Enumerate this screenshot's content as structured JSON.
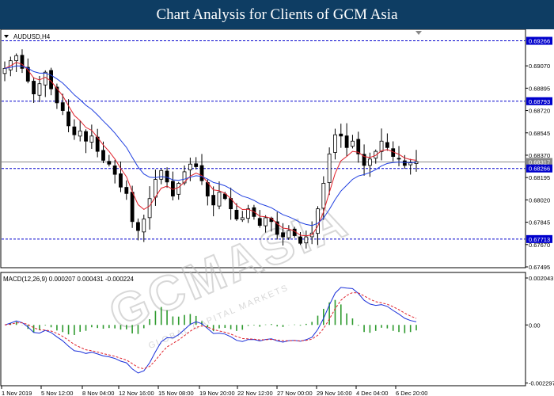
{
  "header": {
    "title": "Chart Analysis for Clients of GCM Asia"
  },
  "watermark": {
    "text": "GCMASIA",
    "sub": "GLOBAL CAPITAL MARKETS"
  },
  "chart_data": [
    {
      "type": "candlestick",
      "symbol_label": "AUDUSD,H4",
      "ylim": [
        0.67495,
        0.6935
      ],
      "y_ticks": [
        "0.69070",
        "0.68895",
        "0.68720",
        "0.68545",
        "0.68370",
        "0.68195",
        "0.68020",
        "0.67845",
        "0.67670",
        "0.67495"
      ],
      "y_tick_values": [
        0.6907,
        0.68895,
        0.6872,
        0.68545,
        0.6837,
        0.68195,
        0.6802,
        0.67845,
        0.6767,
        0.67495
      ],
      "x_labels": [
        "1 Nov 2019",
        "5 Nov 12:00",
        "8 Nov 04:00",
        "12 Nov 16:00",
        "15 Nov 08:00",
        "19 Nov 20:00",
        "22 Nov 12:00",
        "27 Nov 00:00",
        "29 Nov 16:00",
        "4 Dec 04:00",
        "6 Dec 20:00"
      ],
      "levels": [
        {
          "value": 0.69266,
          "label": "0.69266",
          "color": "#0000cc"
        },
        {
          "value": 0.68793,
          "label": "0.68793",
          "color": "#0000cc"
        },
        {
          "value": 0.68266,
          "label": "0.68266",
          "color": "#0000cc"
        },
        {
          "value": 0.67713,
          "label": "0.67713",
          "color": "#0000cc"
        }
      ],
      "current_price": {
        "value": 0.68317,
        "label": "0.68317",
        "color": "#888888"
      },
      "close_path": [
        0.6905,
        0.6911,
        0.6915,
        0.6905,
        0.6895,
        0.6885,
        0.6893,
        0.6902,
        0.6889,
        0.6878,
        0.6872,
        0.686,
        0.6853,
        0.6856,
        0.6848,
        0.6852,
        0.684,
        0.6833,
        0.683,
        0.6822,
        0.6812,
        0.6807,
        0.6785,
        0.6778,
        0.6787,
        0.6803,
        0.6818,
        0.6825,
        0.6816,
        0.6805,
        0.6815,
        0.6824,
        0.683,
        0.6828,
        0.6817,
        0.6805,
        0.6798,
        0.6808,
        0.6803,
        0.6795,
        0.6787,
        0.6788,
        0.6795,
        0.6789,
        0.6782,
        0.6788,
        0.6785,
        0.6775,
        0.6773,
        0.6778,
        0.6774,
        0.6768,
        0.6773,
        0.6776,
        0.6795,
        0.6815,
        0.6838,
        0.6853,
        0.6852,
        0.6843,
        0.6848,
        0.6838,
        0.6829,
        0.6834,
        0.684,
        0.6848,
        0.6843,
        0.6836,
        0.6834,
        0.6829,
        0.6831,
        0.6832
      ],
      "series": [
        {
          "name": "MA fast",
          "color": "#e0202a"
        },
        {
          "name": "MA slow",
          "color": "#1f3fe0"
        }
      ]
    },
    {
      "type": "macd",
      "label": "MACD(12,26,9) 0.000207 0.000431 -0.000224",
      "ylim": [
        -0.00237,
        0.002043
      ],
      "y_ticks": [
        "0.002043",
        "0.00",
        "-0.002297"
      ],
      "y_tick_values": [
        0.002043,
        0.0,
        -0.002297
      ],
      "series": [
        {
          "name": "MACD",
          "color": "#1a2fd9"
        },
        {
          "name": "Signal",
          "color": "#e0202a"
        },
        {
          "name": "Histogram",
          "color": "#2e9a2e"
        }
      ]
    }
  ]
}
